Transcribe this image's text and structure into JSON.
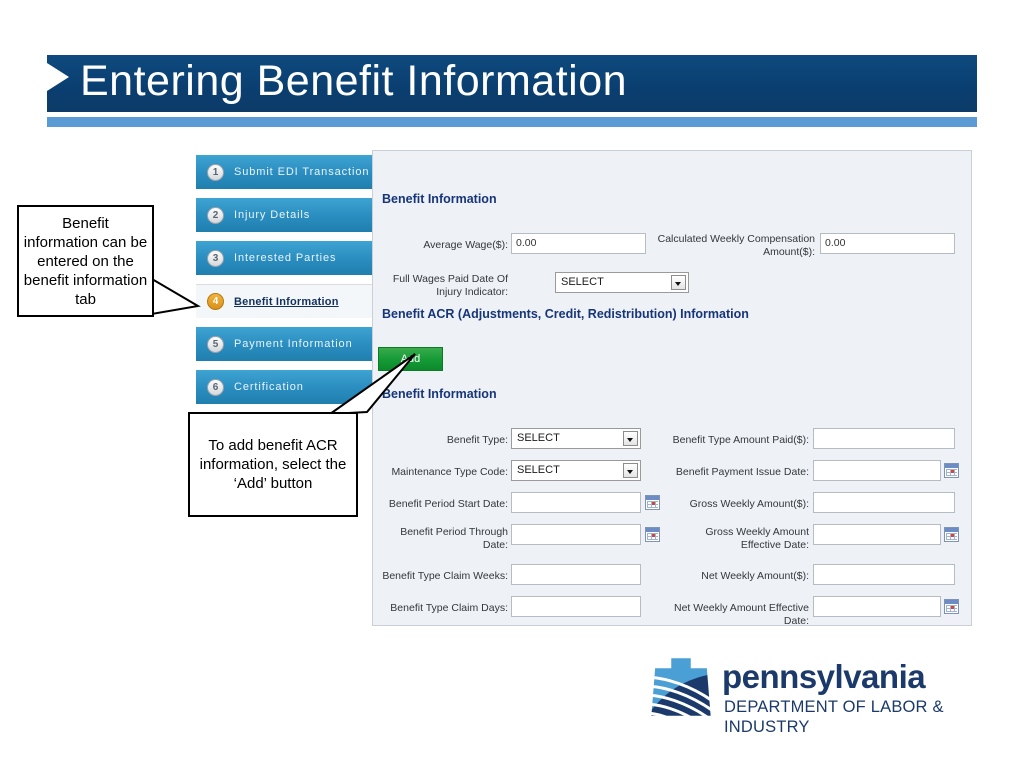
{
  "slide": {
    "title": "Entering Benefit Information"
  },
  "sidebar": {
    "items": [
      {
        "number": "1",
        "label": "Submit EDI Transaction",
        "active": false
      },
      {
        "number": "2",
        "label": "Injury Details",
        "active": false
      },
      {
        "number": "3",
        "label": "Interested Parties",
        "active": false
      },
      {
        "number": "4",
        "label": "Benefit Information",
        "active": true
      },
      {
        "number": "5",
        "label": "Payment Information",
        "active": false
      },
      {
        "number": "6",
        "label": "Certification",
        "active": false
      }
    ]
  },
  "form": {
    "section_benefit_information_top": "Benefit Information",
    "section_acr": "Benefit ACR (Adjustments, Credit, Redistribution) Information",
    "section_benefit_information_bottom": "Benefit Information",
    "add_button": "Add",
    "fields": {
      "average_wage_label": "Average Wage($):",
      "average_wage_value": "0.00",
      "calculated_weekly_label": "Calculated Weekly Compensation Amount($):",
      "calculated_weekly_value": "0.00",
      "full_wages_label": "Full Wages Paid Date Of Injury Indicator:",
      "full_wages_value": "SELECT",
      "benefit_type_label": "Benefit Type:",
      "benefit_type_value": "SELECT",
      "maintenance_type_label": "Maintenance Type Code:",
      "maintenance_type_value": "SELECT",
      "benefit_period_start_label": "Benefit Period Start Date:",
      "benefit_period_start_value": "",
      "benefit_period_through_label": "Benefit Period Through Date:",
      "benefit_period_through_value": "",
      "benefit_claim_weeks_label": "Benefit Type Claim Weeks:",
      "benefit_claim_weeks_value": "",
      "benefit_claim_days_label": "Benefit Type Claim Days:",
      "benefit_claim_days_value": "",
      "benefit_amount_paid_label": "Benefit Type Amount Paid($):",
      "benefit_amount_paid_value": "",
      "benefit_payment_issue_label": "Benefit Payment Issue Date:",
      "benefit_payment_issue_value": "",
      "gross_weekly_label": "Gross Weekly Amount($):",
      "gross_weekly_value": "",
      "gross_weekly_eff_label": "Gross Weekly Amount Effective Date:",
      "gross_weekly_eff_value": "",
      "net_weekly_label": "Net Weekly Amount($):",
      "net_weekly_value": "",
      "net_weekly_eff_label": "Net Weekly Amount Effective Date:",
      "net_weekly_eff_value": ""
    }
  },
  "callouts": [
    {
      "text": "Benefit information can be entered on the benefit information tab"
    },
    {
      "text": "To add benefit ACR information, select the ‘Add’ button"
    }
  ],
  "logo": {
    "wordmark": "pennsylvania",
    "subtitle": "DEPARTMENT OF LABOR & INDUSTRY"
  },
  "colors": {
    "banner_navy": "#0b4478",
    "banner_underline": "#5b9bd5",
    "tab_blue": "#2d90c2",
    "active_badge_orange": "#d8921c",
    "heading_navy": "#17357a",
    "add_green": "#179c38",
    "logo_navy": "#1b3a6b"
  }
}
